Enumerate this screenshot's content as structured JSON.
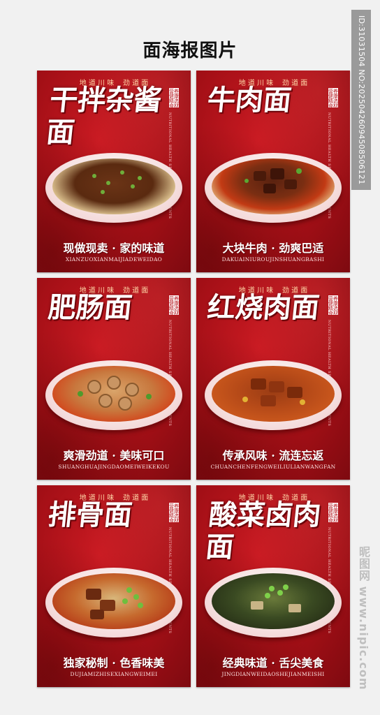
{
  "title": "面海报图片",
  "watermark_id": "ID:31031504 NO:20250426094508506121",
  "watermark_site": "昵图网 www.nipic.com",
  "colors": {
    "poster_red": "#b3121a",
    "bg": "#f1f1f1"
  },
  "posters": [
    {
      "tagline": "地 道 川 味    劲 道 面",
      "name": "干拌杂酱面",
      "seal": "营养健康 精选食材",
      "side_text": "NUTRITIONAL HEALTH SELECTED INGREDIENTS",
      "slogan": "现做现卖 · 家的味道",
      "pinyin": "XIANZUOXIANMAIJIADEWEIDAO"
    },
    {
      "tagline": "地 道 川 味    劲 道 面",
      "name": "牛肉面",
      "seal": "营养健康 精选食材",
      "side_text": "NUTRITIONAL HEALTH SELECTED INGREDIENTS",
      "slogan": "大块牛肉 · 劲爽巴适",
      "pinyin": "DAKUAINIUROUJINSHUANGBASHI"
    },
    {
      "tagline": "地 道 川 味    劲 道 面",
      "name": "肥肠面",
      "seal": "营养健康 精选食材",
      "side_text": "NUTRITIONAL HEALTH SELECTED INGREDIENTS",
      "slogan": "爽滑劲道 · 美味可口",
      "pinyin": "SHUANGHUAJINGDAOMEIWEIKEKOU"
    },
    {
      "tagline": "地 道 川 味    劲 道 面",
      "name": "红烧肉面",
      "seal": "营养健康 精选食材",
      "side_text": "NUTRITIONAL HEALTH SELECTED INGREDIENTS",
      "slogan": "传承风味 · 流连忘返",
      "pinyin": "CHUANCHENFENGWEILIULIANWANGFAN"
    },
    {
      "tagline": "地 道 川 味    劲 道 面",
      "name": "排骨面",
      "seal": "营养健康 精选食材",
      "side_text": "NUTRITIONAL HEALTH SELECTED INGREDIENTS",
      "slogan": "独家秘制 · 色香味美",
      "pinyin": "DUJIAMIZHISEXIANGWEIMEI"
    },
    {
      "tagline": "地 道 川 味    劲 道 面",
      "name": "酸菜卤肉面",
      "seal": "营养健康 精选食材",
      "side_text": "NUTRITIONAL HEALTH SELECTED INGREDIENTS",
      "slogan": "经典味道 · 舌尖美食",
      "pinyin": "JINGDIANWEIDAOSHEJIANMEISHI"
    }
  ]
}
